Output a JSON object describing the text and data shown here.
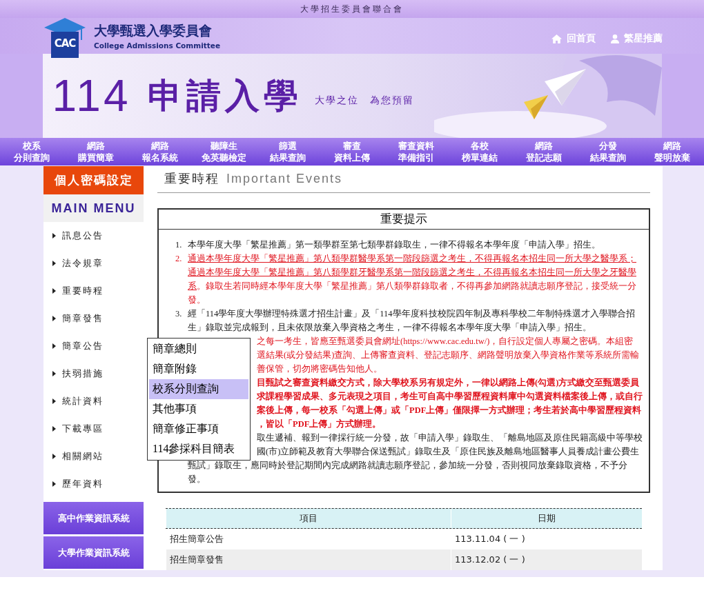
{
  "top_bar": {
    "title": "大學招生委員會聯合會"
  },
  "header": {
    "logo_mark": "CAC",
    "org_name": "大學甄選入學委員會",
    "org_name_en": "College Admissions Committee",
    "links": [
      {
        "kind": "home",
        "label": "回首頁"
      },
      {
        "kind": "user",
        "label": "繁星推薦"
      }
    ]
  },
  "banner": {
    "title_number": "114",
    "title": "申請入學",
    "slogan": "大學之位　為您預留"
  },
  "nav": [
    {
      "lines": [
        "校系",
        "分則查詢"
      ]
    },
    {
      "lines": [
        "網路",
        "購買簡章"
      ]
    },
    {
      "lines": [
        "網路",
        "報名系統"
      ]
    },
    {
      "lines": [
        "聽障生",
        "免英聽檢定"
      ]
    },
    {
      "lines": [
        "篩選",
        "結果查詢"
      ]
    },
    {
      "lines": [
        "審查",
        "資料上傳"
      ]
    },
    {
      "lines": [
        "審查資料",
        "準備指引"
      ]
    },
    {
      "lines": [
        "各校",
        "榜單連結"
      ]
    },
    {
      "lines": [
        "網路",
        "登記志願"
      ]
    },
    {
      "lines": [
        "分發",
        "結果查詢"
      ]
    },
    {
      "lines": [
        "網路",
        "聲明放棄"
      ]
    }
  ],
  "sidebar": {
    "password_button": "個人密碼設定",
    "menu_title": "MAIN MENU",
    "items": [
      {
        "label": "訊息公告"
      },
      {
        "label": "法令規章"
      },
      {
        "label": "重要時程"
      },
      {
        "label": "簡章發售"
      },
      {
        "label": "簡章公告"
      },
      {
        "label": "扶弱措施"
      },
      {
        "label": "統計資料"
      },
      {
        "label": "下載專區"
      },
      {
        "label": "相關網站"
      },
      {
        "label": "歷年資料"
      }
    ],
    "systems": [
      "高中作業資訊系統",
      "大學作業資訊系統"
    ]
  },
  "popup_menu": [
    {
      "label": "簡章總則",
      "selected": false
    },
    {
      "label": "簡章附錄",
      "selected": false
    },
    {
      "label": "校系分則查詢",
      "selected": true
    },
    {
      "label": "其他事項",
      "selected": false
    },
    {
      "label": "簡章修正事項",
      "selected": false
    },
    {
      "label": "114參採科目簡表",
      "selected": false
    }
  ],
  "page_title": {
    "title": "重要時程",
    "title_en": "Important Events"
  },
  "notice": {
    "heading": "重要提示",
    "items": [
      {
        "kind": "full",
        "number": "1.",
        "red": false,
        "bold": false,
        "segments": [
          {
            "text": "本學年度大學「繁星推薦」第一類學群至第七類學群錄取生，一律不得報名本學年度「申請入學」招生。",
            "underline": false
          }
        ]
      },
      {
        "kind": "full",
        "number": "2.",
        "red": true,
        "bold": false,
        "segments": [
          {
            "text": "通過本學年度大學「繁星推薦」第八類學群醫學系第一階段篩選之考生，不得再報名本招生同一所大學之醫學系；通過本學年度大學「繁星推薦」第八類學群牙醫學系第一階段篩選之考生，不得再報名本招生同一所大學之牙醫學系",
            "underline": true
          },
          {
            "text": "。錄取生若同時經本學年度大學「繁星推薦」第八類學群錄取者，不得再參加網路就讀志願序登記，接受統一分發。",
            "underline": false
          }
        ]
      },
      {
        "kind": "full",
        "number": "3.",
        "red": false,
        "bold": false,
        "segments": [
          {
            "text": "經「114學年度大學辦理特殊選才招生計畫」及「114學年度科技校院四年制及專科學校二年制特殊選才入學聯合招生」錄取並完成報到，且未依限放棄入學資格之考生，一律不得報名本學年度大學「申請入學」招生。",
            "underline": false
          }
        ]
      },
      {
        "kind": "lines",
        "red": true,
        "bold": false,
        "lines": [
          {
            "text": "之每一考生，皆應至甄選委員會網址(https://www.cac.edu.tw/)，自行設定個人專屬之密碼。本組密",
            "behind_menu": true
          },
          {
            "text": "選結果(或分發結果)查詢、上傳審查資料、登記志願序、網路聲明放棄入學資格作業等系統所需輸",
            "behind_menu": true
          },
          {
            "text": "善保管，切勿將密碼告知他人。",
            "behind_menu": true
          }
        ]
      },
      {
        "kind": "lines",
        "red": true,
        "bold": true,
        "lines": [
          {
            "text": "目甄試之審查資料繳交方式，除大學校系另有規定外，一律以網路上傳(勾選)方式繳交至甄選委員",
            "behind_menu": true
          },
          {
            "text": "求課程學習成果、多元表現之項目，考生可自高中學習歷程資料庫中勾選資料檔案後上傳，或自行",
            "behind_menu": true
          },
          {
            "text": "案後上傳，每一校系「勾選上傳」或「PDF上傳」僅限擇一方式辦理；考生若於高中學習歷程資料",
            "behind_menu": true
          },
          {
            "text": "，皆以「PDF上傳」方式辦理。",
            "behind_menu": true
          }
        ]
      },
      {
        "kind": "lines",
        "red": false,
        "bold": false,
        "lines": [
          {
            "text": "取生遞補、報到一律採行統一分發，故「申請入學」錄取生、「離島地區及原住民籍高級中等學校",
            "behind_menu": true
          },
          {
            "text": "國(市)立師範及教育大學聯合保送甄試」錄取生及「原住民族及離島地區醫事人員養成計畫公費生",
            "behind_menu": true
          },
          {
            "text": "甄試」錄取生，應同時於登記期間內完成網路就讀志願序登記，參加統一分發，否則視同放棄錄取資格，不予分",
            "behind_menu": false
          },
          {
            "text": "發。",
            "behind_menu": false
          }
        ]
      }
    ]
  },
  "table": {
    "columns": [
      "項目",
      "日期"
    ],
    "rows": [
      [
        "招生簡章公告",
        "113.11.04 ( 一 )"
      ],
      [
        "招生簡章發售",
        "113.12.02 ( 一 )"
      ]
    ]
  }
}
